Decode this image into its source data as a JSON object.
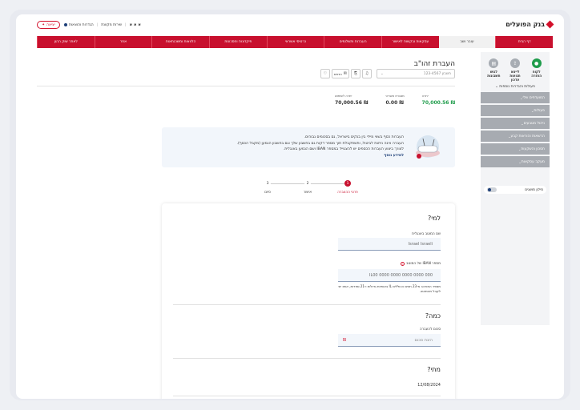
{
  "header": {
    "logo_text": "בנק הפועלים",
    "font_size_label": "א א א",
    "links": [
      "שירות מקוונת",
      "הגדרות והוצאות"
    ],
    "logout_label": "יציאה"
  },
  "nav": {
    "items": [
      {
        "label": "דף הבית",
        "active": false
      },
      {
        "label": "עובר ושב",
        "active": true
      },
      {
        "label": "עסקאות ובקשות לאישור",
        "active": false
      },
      {
        "label": "העברות ותשלומים",
        "active": false
      },
      {
        "label": "כרטיסי אשראי",
        "active": false
      },
      {
        "label": "פיקדונות וחסכונות",
        "active": false
      },
      {
        "label": "הלוואות ומשכנתאות",
        "active": false
      },
      {
        "label": "אחר",
        "active": false
      },
      {
        "label": "לאתר שוק ההון",
        "active": false
      }
    ]
  },
  "sidebar": {
    "actions": [
      {
        "label": "לקוח החזרה",
        "icon": "lock-icon"
      },
      {
        "label": "לייצא תנועות עדכון",
        "icon": "export-icon"
      },
      {
        "label": "לגוש חשבונות",
        "icon": "document-icon"
      }
    ],
    "more_label": "פעולות והגדרות נוספות",
    "sections": [
      "המועדפים שלי",
      "פעולות",
      "ניהול מטבעים",
      "הרשאות והוראות קבע",
      "חסכון והשקעות",
      "מעקב עסקאות"
    ],
    "toggle_label": "מילון מושגים"
  },
  "main": {
    "title": "העברת זהו\"ב",
    "account_placeholder": "חשבון 123-4567",
    "toolbar": {
      "print_label": "הדפס"
    },
    "balances": [
      {
        "label": "יתרה",
        "value": "70,000.56",
        "prefix": "₪",
        "color": "green"
      },
      {
        "label": "מסגרת אשראי",
        "value": "0.00",
        "prefix": "₪",
        "color": ""
      },
      {
        "label": "יתרה לשימוש",
        "value": "70,000.56",
        "prefix": "₪",
        "color": ""
      }
    ],
    "info": {
      "line1": "העברות כסף בשווי מיידי בין בנקים בישראל, גם בסכומים גבוהים.",
      "line2": "העברה אינה ניתנת לביטול, ותשתקבלת תוך מספר דקות גם בחשבון שלך וגם בחשבון הנמען (מקבל הכסף).",
      "line3": "לצורך ביצוע העברות הכספים יש להצטייד במספר IBAN ושם הנמען באנגלית.",
      "link": "למידע נוסף"
    },
    "steps": [
      {
        "num": "1",
        "label": "פרטי ההעברה",
        "active": true
      },
      {
        "num": "2",
        "label": "אישור",
        "active": false
      },
      {
        "num": "3",
        "label": "סיום",
        "active": false
      }
    ],
    "form": {
      "who_title": "למי?",
      "name_label": "שם המוטב באנגלית",
      "name_value": "Israel Israeli",
      "iban_label": "מספר IBAN של המוטב",
      "iban_value": "IL00 0000 0000 0000 0000 000",
      "iban_hint": "מספר המורכב מ-23 תווים הכוללים IL באותיות גדולות ו-21 ספרות, אותו יש לקבל מהמוטב.",
      "amount_title": "כמה?",
      "amount_label": "סכום להעברה",
      "amount_placeholder": "הזנת סכום",
      "when_title": "מתי?",
      "date_value": "12/08/2024"
    }
  },
  "colors": {
    "brand": "#c8102e",
    "accent": "#1d3f78",
    "positive": "#1f9c4b"
  }
}
